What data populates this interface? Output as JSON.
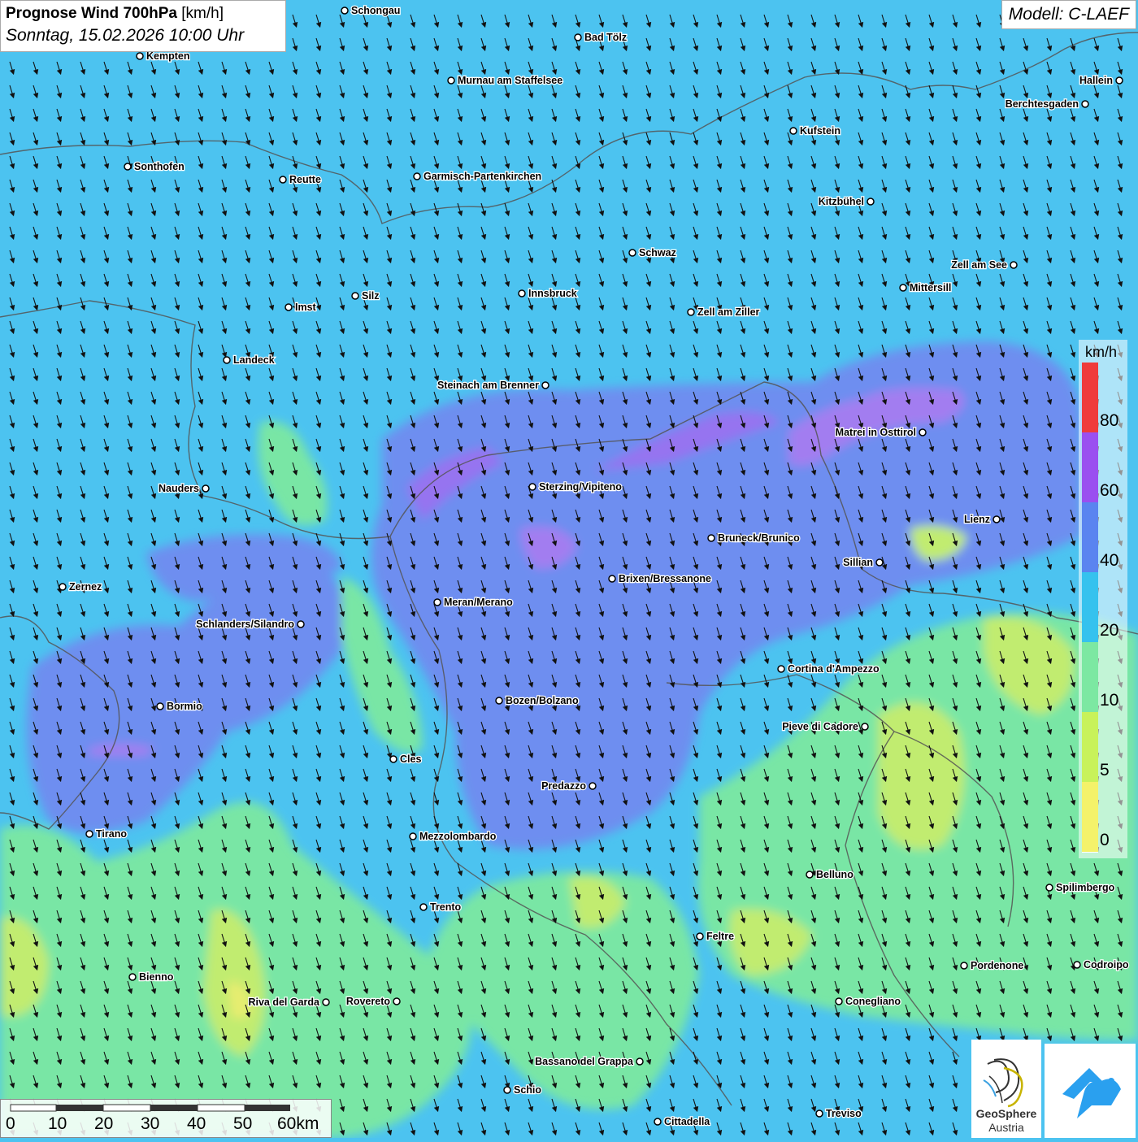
{
  "title": {
    "main": "Prognose Wind 700hPa",
    "unit": "[km/h]",
    "datetime": "Sonntag, 15.02.2026 10:00 Uhr"
  },
  "model": "Modell: C-LAEF",
  "legend": {
    "unit": "km/h",
    "ticks": [
      "80",
      "60",
      "40",
      "20",
      "10",
      "5",
      "0"
    ],
    "colors": [
      "#ef3b3b",
      "#9a4ff0",
      "#5a84f0",
      "#35c2ee",
      "#7ce8a2",
      "#c8f25a",
      "#f4f26a"
    ]
  },
  "scalebar": {
    "ticks": [
      "0",
      "10",
      "20",
      "30",
      "40",
      "50",
      "60km"
    ]
  },
  "logo": {
    "line1": "GeoSphere",
    "line2": "Austria"
  },
  "cities": [
    {
      "name": "Schongau"
    },
    {
      "name": "Bad Tölz"
    },
    {
      "name": "Kempten"
    },
    {
      "name": "Murnau am Staffelsee"
    },
    {
      "name": "Hallein"
    },
    {
      "name": "Berchtesgaden"
    },
    {
      "name": "Kufstein"
    },
    {
      "name": "Sonthofen"
    },
    {
      "name": "Reutte"
    },
    {
      "name": "Garmisch-Partenkirchen"
    },
    {
      "name": "Kitzbühel"
    },
    {
      "name": "Schwaz"
    },
    {
      "name": "Zell am See"
    },
    {
      "name": "Mittersill"
    },
    {
      "name": "Innsbruck"
    },
    {
      "name": "Silz"
    },
    {
      "name": "Imst"
    },
    {
      "name": "Zell am Ziller"
    },
    {
      "name": "Landeck"
    },
    {
      "name": "Steinach am Brenner"
    },
    {
      "name": "Matrei in Osttirol"
    },
    {
      "name": "Nauders"
    },
    {
      "name": "Sterzing/Vipiteno"
    },
    {
      "name": "Lienz"
    },
    {
      "name": "Bruneck/Brunico"
    },
    {
      "name": "Sillian"
    },
    {
      "name": "Zernez"
    },
    {
      "name": "Brixen/Bressanone"
    },
    {
      "name": "Meran/Merano"
    },
    {
      "name": "Schlanders/Silandro"
    },
    {
      "name": "Cortina d'Ampezzo"
    },
    {
      "name": "Bormio"
    },
    {
      "name": "Bozen/Bolzano"
    },
    {
      "name": "Pieve di Cadore"
    },
    {
      "name": "Cles"
    },
    {
      "name": "Predazzo"
    },
    {
      "name": "Tirano"
    },
    {
      "name": "Mezzolombardo"
    },
    {
      "name": "Belluno"
    },
    {
      "name": "Spilimbergo"
    },
    {
      "name": "Trento"
    },
    {
      "name": "Feltre"
    },
    {
      "name": "Bienno"
    },
    {
      "name": "Pordenone"
    },
    {
      "name": "Codroipo"
    },
    {
      "name": "Riva del Garda"
    },
    {
      "name": "Rovereto"
    },
    {
      "name": "Conegliano"
    },
    {
      "name": "Bassano del Grappa"
    },
    {
      "name": "Schio"
    },
    {
      "name": "Treviso"
    },
    {
      "name": "Cittadella"
    }
  ]
}
